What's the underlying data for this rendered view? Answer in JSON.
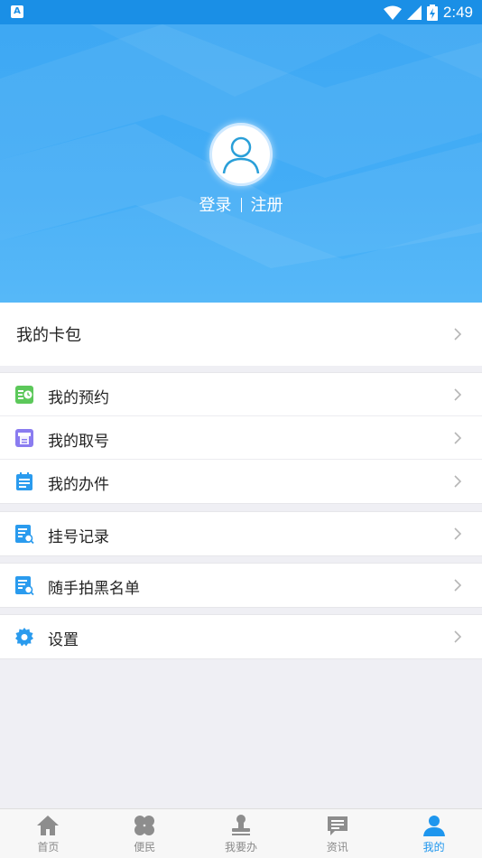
{
  "status_bar": {
    "notification_icon": "A",
    "time": "2:49"
  },
  "profile": {
    "login_label": "登录",
    "register_label": "注册"
  },
  "card_section": {
    "label": "我的卡包"
  },
  "menu": {
    "group1": [
      {
        "label": "我的预约",
        "icon": "appointment-icon",
        "color": "#5cc85a"
      },
      {
        "label": "我的取号",
        "icon": "ticket-icon",
        "color": "#8a7cf0"
      },
      {
        "label": "我的办件",
        "icon": "clipboard-icon",
        "color": "#2a9bee"
      }
    ],
    "registration": {
      "label": "挂号记录",
      "icon": "document-search-icon",
      "color": "#2a9bee"
    },
    "blacklist": {
      "label": "随手拍黑名单",
      "icon": "document-search-icon",
      "color": "#2a9bee"
    },
    "settings": {
      "label": "设置",
      "icon": "gear-icon",
      "color": "#2a9bee"
    }
  },
  "tabbar": [
    {
      "label": "首页",
      "icon": "home-icon"
    },
    {
      "label": "便民",
      "icon": "clover-icon"
    },
    {
      "label": "我要办",
      "icon": "stamp-icon"
    },
    {
      "label": "资讯",
      "icon": "message-icon"
    },
    {
      "label": "我的",
      "icon": "person-icon",
      "active": true
    }
  ]
}
